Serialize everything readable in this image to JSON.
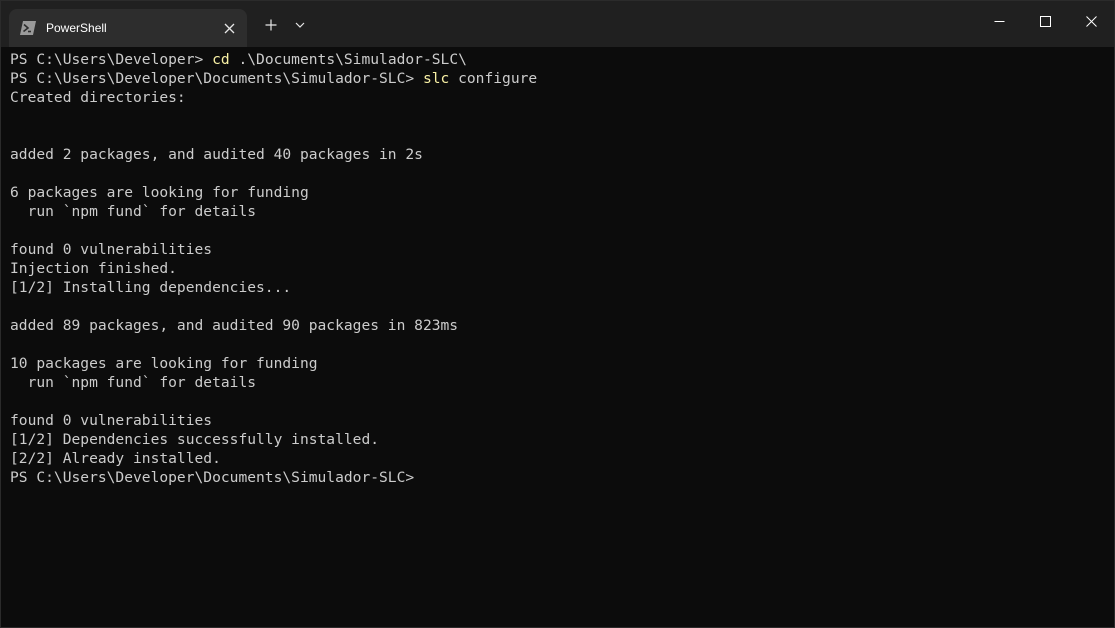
{
  "titlebar": {
    "tab": {
      "title": "PowerShell",
      "icon": "powershell-icon",
      "close_icon": "close-icon"
    },
    "new_tab_icon": "plus-icon",
    "dropdown_icon": "chevron-down-icon",
    "window_controls": [
      "minimize-icon",
      "maximize-icon",
      "close-icon"
    ]
  },
  "colors": {
    "background": "#0c0c0c",
    "titlebar": "#202020",
    "active_tab": "#2d2d2d",
    "text": "#cccccc",
    "command": "#f9f1a5"
  },
  "terminal": {
    "lines": [
      {
        "prompt": "PS C:\\Users\\Developer> ",
        "cmd": "cd",
        "args": " .\\Documents\\Simulador-SLC\\"
      },
      {
        "prompt": "PS C:\\Users\\Developer\\Documents\\Simulador-SLC> ",
        "cmd": "slc",
        "args": " configure"
      },
      {
        "text": "Created directories:"
      },
      {
        "text": ""
      },
      {
        "text": ""
      },
      {
        "text": "added 2 packages, and audited 40 packages in 2s"
      },
      {
        "text": ""
      },
      {
        "text": "6 packages are looking for funding"
      },
      {
        "text": "  run `npm fund` for details"
      },
      {
        "text": ""
      },
      {
        "text": "found 0 vulnerabilities"
      },
      {
        "text": "Injection finished."
      },
      {
        "text": "[1/2] Installing dependencies..."
      },
      {
        "text": ""
      },
      {
        "text": "added 89 packages, and audited 90 packages in 823ms"
      },
      {
        "text": ""
      },
      {
        "text": "10 packages are looking for funding"
      },
      {
        "text": "  run `npm fund` for details"
      },
      {
        "text": ""
      },
      {
        "text": "found 0 vulnerabilities"
      },
      {
        "text": "[1/2] Dependencies successfully installed."
      },
      {
        "text": "[2/2] Already installed."
      },
      {
        "prompt": "PS C:\\Users\\Developer\\Documents\\Simulador-SLC>",
        "cmd": "",
        "args": ""
      }
    ]
  }
}
